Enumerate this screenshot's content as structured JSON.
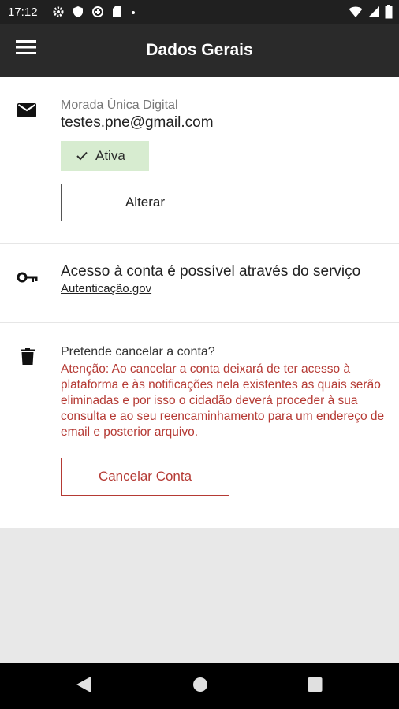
{
  "status_bar": {
    "time": "17:12",
    "icons_left": [
      "settings-icon",
      "shield-icon",
      "data-saver-icon",
      "sd-card-icon",
      "dot-icon"
    ],
    "icons_right": [
      "wifi-icon",
      "signal-icon",
      "battery-icon"
    ]
  },
  "app_bar": {
    "title": "Dados Gerais",
    "menu_icon": "menu-icon"
  },
  "email_section": {
    "icon": "mail-icon",
    "label": "Morada Única Digital",
    "email": "testes.pne@gmail.com",
    "status": "Ativa",
    "status_icon": "check-icon",
    "status_color": "#d7ecd0",
    "button": "Alterar"
  },
  "access_section": {
    "icon": "key-icon",
    "text": "Acesso à conta é possível através do serviço",
    "link": "Autenticação.gov"
  },
  "cancel_section": {
    "icon": "trash-icon",
    "question": "Pretende cancelar a conta?",
    "warning": "Atenção: Ao cancelar a conta deixará de ter acesso à plataforma e às notificações nela existentes as quais serão eliminadas e por isso o cidadão deverá proceder à sua consulta e ao seu reencaminhamento para um endereço de email e posterior arquivo.",
    "warning_color": "#b53a34",
    "button": "Cancelar Conta"
  },
  "nav_bar": {
    "back": "back-icon",
    "home": "home-icon",
    "recents": "recents-icon"
  }
}
